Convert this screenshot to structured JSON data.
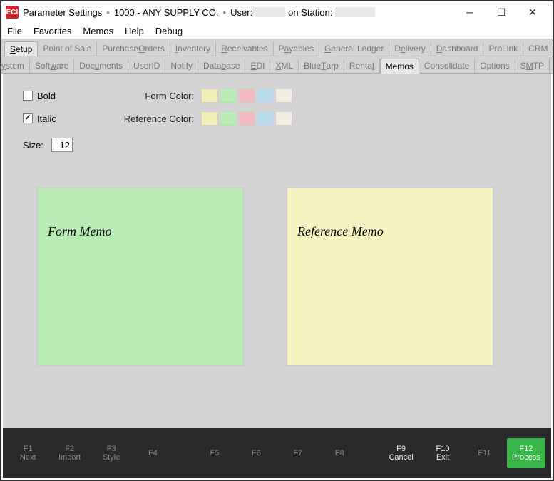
{
  "title": {
    "app_icon": "ECI",
    "segment1": "Parameter Settings",
    "segment2": "1000 - ANY SUPPLY CO.",
    "segment3_prefix": "User:",
    "segment3_mid": "on Station:"
  },
  "menubar": {
    "file": "File",
    "favorites": "Favorites",
    "memos": "Memos",
    "help": "Help",
    "debug": "Debug"
  },
  "tabs_top": {
    "setup": "Setup",
    "pos": "Point of Sale",
    "po": "Purchase Orders",
    "inventory": "Inventory",
    "receivables": "Receivables",
    "payables": "Payables",
    "gl": "General Ledger",
    "delivery": "Delivery",
    "dashboard": "Dashboard",
    "prolink": "ProLink",
    "crm": "CRM"
  },
  "tabs_sub": {
    "system": "System",
    "software": "Software",
    "documents": "Documents",
    "userid": "UserID",
    "notify": "Notify",
    "database": "Database",
    "edi": "EDI",
    "xml": "XML",
    "bluetarp": "BlueTarp",
    "rental": "Rental",
    "memos": "Memos",
    "consolidate": "Consolidate",
    "options": "Options",
    "smtp": "SMTP"
  },
  "form": {
    "bold_label": "Bold",
    "bold_checked": false,
    "italic_label": "Italic",
    "italic_checked": true,
    "form_color_label": "Form Color:",
    "reference_color_label": "Reference Color:",
    "size_label": "Size:",
    "size_value": "12",
    "swatches": [
      "#f2efb6",
      "#b7edb3",
      "#f4b8c0",
      "#b8dced",
      "#f4efe3"
    ]
  },
  "memo": {
    "form_text": "Form Memo",
    "reference_text": "Reference Memo"
  },
  "fkeys": {
    "f1": {
      "key": "F1",
      "label": "Next"
    },
    "f2": {
      "key": "F2",
      "label": "Import"
    },
    "f3": {
      "key": "F3",
      "label": "Style"
    },
    "f4": {
      "key": "F4",
      "label": ""
    },
    "f5": {
      "key": "F5",
      "label": ""
    },
    "f6": {
      "key": "F6",
      "label": ""
    },
    "f7": {
      "key": "F7",
      "label": ""
    },
    "f8": {
      "key": "F8",
      "label": ""
    },
    "f9": {
      "key": "F9",
      "label": "Cancel"
    },
    "f10": {
      "key": "F10",
      "label": "Exit"
    },
    "f11": {
      "key": "F11",
      "label": ""
    },
    "f12": {
      "key": "F12",
      "label": "Process"
    }
  }
}
